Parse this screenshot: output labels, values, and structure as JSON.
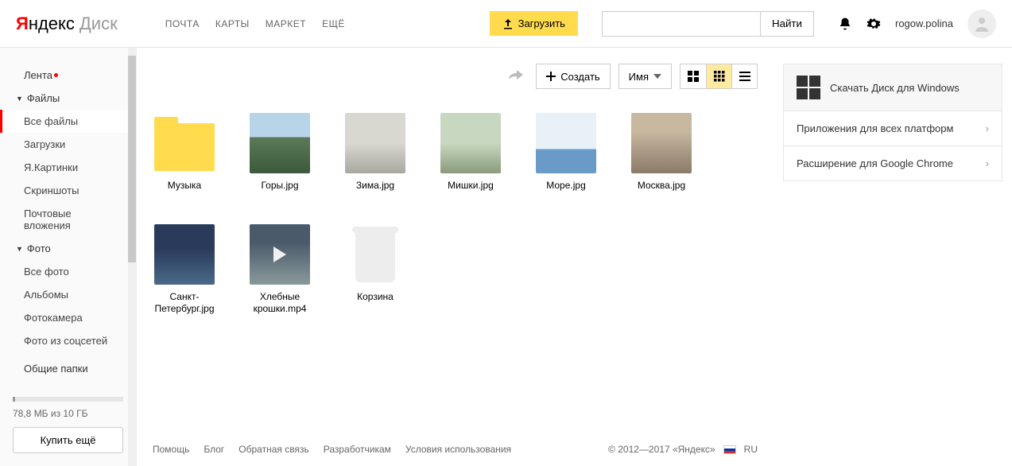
{
  "header": {
    "logo_ya": "Я",
    "logo_rest": "ндекс",
    "logo_disk": "Диск",
    "nav": [
      "ПОЧТА",
      "КАРТЫ",
      "МАРКЕТ",
      "ЕЩЁ"
    ],
    "upload": "Загрузить",
    "search_btn": "Найти",
    "username": "rogow.polina"
  },
  "sidebar": {
    "feed": "Лента",
    "files": "Файлы",
    "files_children": [
      "Все файлы",
      "Загрузки",
      "Я.Картинки",
      "Скриншоты",
      "Почтовые вложения"
    ],
    "photo": "Фото",
    "photo_children": [
      "Все фото",
      "Альбомы",
      "Фотокамера",
      "Фото из соцсетей"
    ],
    "shared": "Общие папки",
    "storage": "78,8 МБ из 10 ГБ",
    "buy": "Купить ещё"
  },
  "toolbar": {
    "create": "Создать",
    "sort": "Имя"
  },
  "files": [
    {
      "name": "Музыка",
      "type": "folder"
    },
    {
      "name": "Горы.jpg",
      "type": "image",
      "cls": "th-mountain"
    },
    {
      "name": "Зима.jpg",
      "type": "image",
      "cls": "th-winter"
    },
    {
      "name": "Мишки.jpg",
      "type": "image",
      "cls": "th-bears"
    },
    {
      "name": "Море.jpg",
      "type": "image",
      "cls": "th-sea"
    },
    {
      "name": "Москва.jpg",
      "type": "image",
      "cls": "th-moscow"
    },
    {
      "name": "Санкт-Петербург.jpg",
      "type": "image",
      "cls": "th-spb"
    },
    {
      "name": "Хлебные крошки.mp4",
      "type": "video",
      "cls": "th-video"
    },
    {
      "name": "Корзина",
      "type": "trash"
    }
  ],
  "right_panel": {
    "download": "Скачать Диск для Windows",
    "apps": "Приложения для всех платформ",
    "ext": "Расширение для Google Chrome"
  },
  "footer": {
    "links": [
      "Помощь",
      "Блог",
      "Обратная связь",
      "Разработчикам",
      "Условия использования"
    ],
    "copyright": "© 2012—2017 «Яндекс»",
    "lang": "RU"
  }
}
